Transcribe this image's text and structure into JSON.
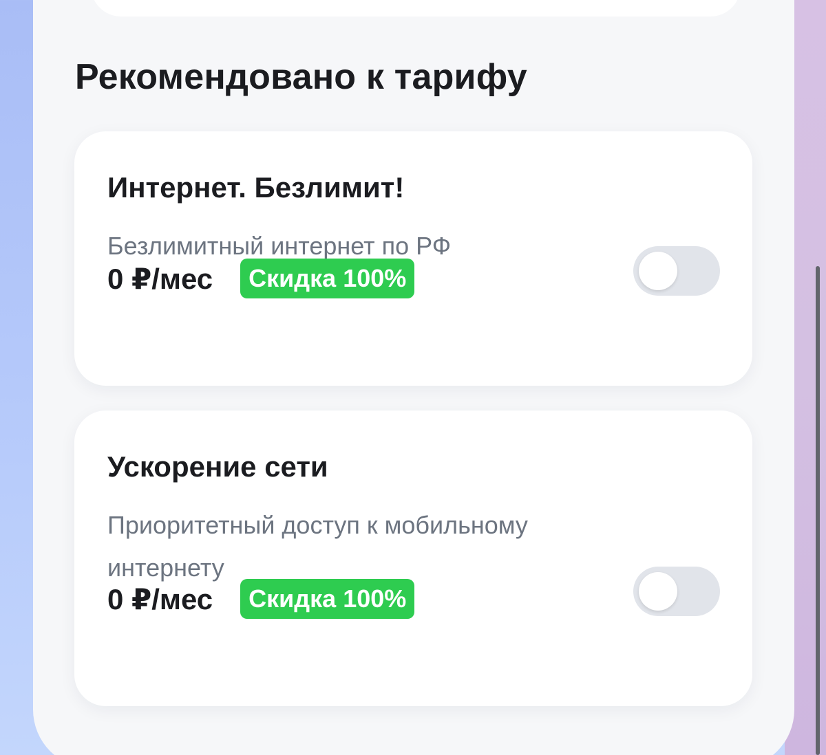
{
  "section": {
    "title": "Рекомендовано к тарифу"
  },
  "options": [
    {
      "title": "Интернет. Безлимит!",
      "description": "Безлимитный интернет по РФ",
      "price": "0 ₽/мес",
      "discount_badge": "Скидка 100%",
      "enabled": false
    },
    {
      "title": "Ускорение сети",
      "description": "Приоритетный доступ к мобильному интернету",
      "price": "0 ₽/мес",
      "discount_badge": "Скидка 100%",
      "enabled": false
    }
  ],
  "colors": {
    "badge_green": "#2ecc50",
    "toggle_off": "#e1e4ea",
    "sheet_bg": "#f6f7f9"
  }
}
